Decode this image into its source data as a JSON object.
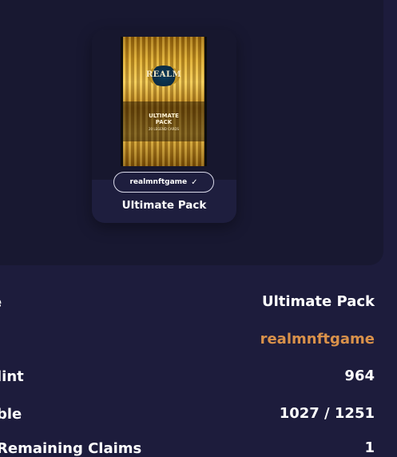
{
  "card": {
    "creator_pill": "realmnftgame",
    "name": "Ultimate Pack",
    "pack_art": {
      "brand": "REALM",
      "title_line1": "ULTIMATE",
      "title_line2": "PACK",
      "subtitle": "20 LEGEND CARDS"
    }
  },
  "details": [
    {
      "label": "e",
      "value": "Ultimate Pack"
    },
    {
      "label": "",
      "value": "realmnftgame"
    },
    {
      "label": "lint",
      "value": "964"
    },
    {
      "label": "ble",
      "value": "1027 / 1251"
    },
    {
      "label": "Remaining Claims",
      "value": "1"
    }
  ],
  "colors": {
    "background": "#1d1c3c",
    "panel": "#181831",
    "accent": "#d9914a"
  }
}
